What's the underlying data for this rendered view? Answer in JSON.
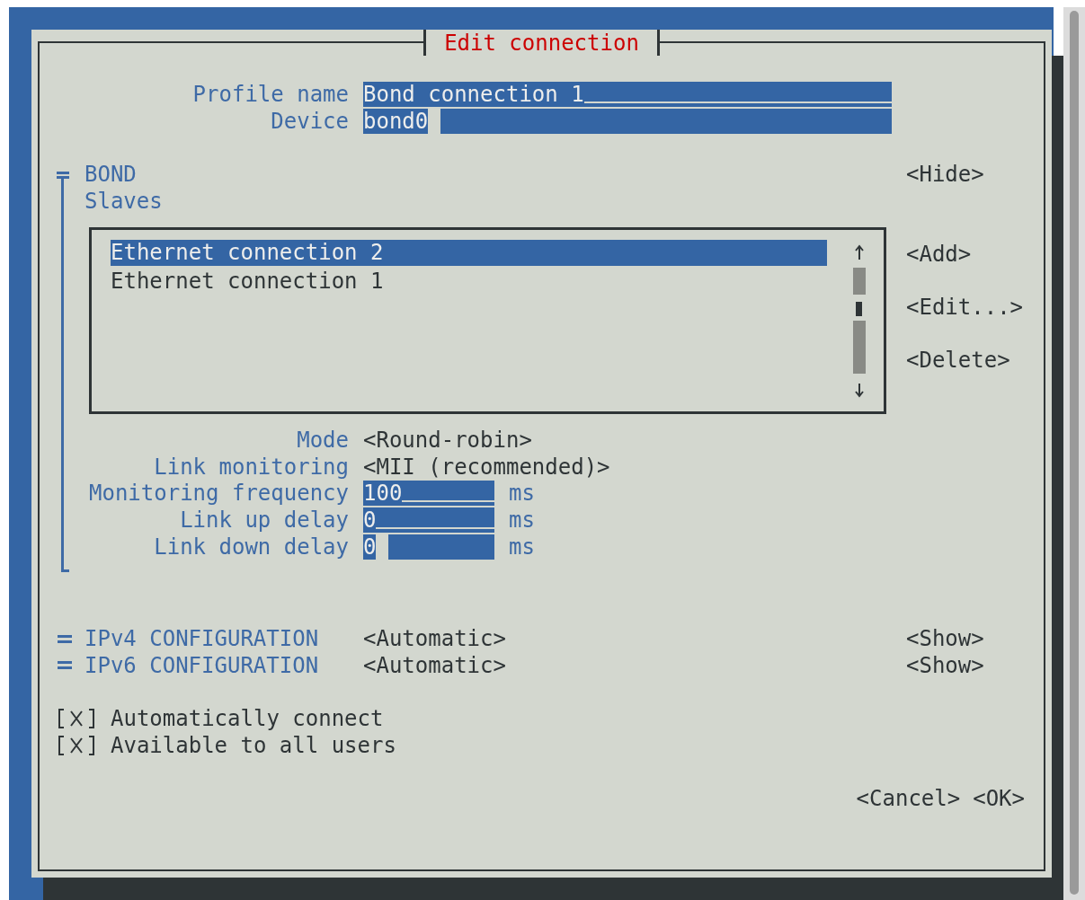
{
  "window": {
    "title": "Edit connection"
  },
  "fields": [
    {
      "label": "Profile name",
      "value": "Bond connection 1",
      "cursor": false
    },
    {
      "label": "Device",
      "value": "bond0",
      "cursor": true
    }
  ],
  "bond": {
    "title": "BOND",
    "toggle": "<Hide>",
    "slaves_label": "Slaves",
    "slaves": [
      {
        "name": "Ethernet connection 2",
        "selected": true
      },
      {
        "name": "Ethernet connection 1",
        "selected": false
      }
    ],
    "slave_buttons": [
      "<Add>",
      "<Edit...>",
      "<Delete>"
    ],
    "settings": [
      {
        "kind": "choice",
        "label": "Mode",
        "value": "<Round-robin>"
      },
      {
        "kind": "choice",
        "label": "Link monitoring",
        "value": "<MII (recommended)>"
      },
      {
        "kind": "number",
        "label": "Monitoring frequency",
        "value": "100",
        "unit": "ms",
        "cursor": false
      },
      {
        "kind": "number",
        "label": "Link up delay",
        "value": "0",
        "unit": "ms",
        "cursor": false
      },
      {
        "kind": "number",
        "label": "Link down delay",
        "value": "0",
        "unit": "ms",
        "cursor": true
      }
    ]
  },
  "sections": [
    {
      "title": "IPv4 CONFIGURATION",
      "value": "<Automatic>",
      "toggle": "<Show>"
    },
    {
      "title": "IPv6 CONFIGURATION",
      "value": "<Automatic>",
      "toggle": "<Show>"
    }
  ],
  "checkboxes": [
    {
      "label": "Automatically connect",
      "checked": true
    },
    {
      "label": "Available to all users",
      "checked": true
    }
  ],
  "buttons": [
    "<Cancel>",
    "<OK>"
  ]
}
